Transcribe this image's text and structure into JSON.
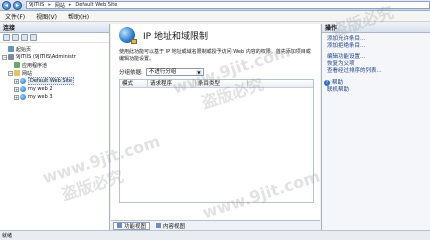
{
  "address": {
    "segments": [
      "9JITIIS",
      "网站",
      "Default Web Site"
    ],
    "separator": "▸"
  },
  "menu": [
    "文件(F)",
    "视图(V)",
    "帮助(H)"
  ],
  "connections": {
    "title": "连接",
    "tree": [
      {
        "label": "起始页",
        "indent": 1,
        "expander": "",
        "icon": "home"
      },
      {
        "label": "9JITIIS (9JITIIS\\Administr",
        "indent": 0,
        "expander": "−",
        "icon": "server"
      },
      {
        "label": "应用程序池",
        "indent": 2,
        "expander": "",
        "icon": "pool"
      },
      {
        "label": "网站",
        "indent": 1,
        "expander": "−",
        "icon": "folder"
      },
      {
        "label": "Default Web Site",
        "indent": 2,
        "expander": "+",
        "icon": "globe",
        "selected": true
      },
      {
        "label": "my web 2",
        "indent": 2,
        "expander": "+",
        "icon": "globe"
      },
      {
        "label": "my web 3",
        "indent": 2,
        "expander": "+",
        "icon": "globe"
      }
    ]
  },
  "main": {
    "title": "IP 地址和域限制",
    "description": "使用此功能可以基于 IP 地址或域名限制或授予访问 Web 内容的权限。首先添加项目或编辑功能设置。",
    "group_label": "分组依据:",
    "group_value": "不进行分组",
    "columns": [
      "模式",
      "请求程序",
      "条目类型"
    ],
    "tabs": [
      "功能视图",
      "内容视图"
    ]
  },
  "actions": {
    "title": "操作",
    "links": [
      "添加允许条目...",
      "添加拒绝条目...",
      "编辑功能设置...",
      "恢复为父项",
      "查看经过排序的列表..."
    ],
    "help": [
      "帮助",
      "联机帮助"
    ]
  },
  "status": "就绪",
  "watermarks": [
    "www.9jit.com",
    "盗版必究"
  ]
}
